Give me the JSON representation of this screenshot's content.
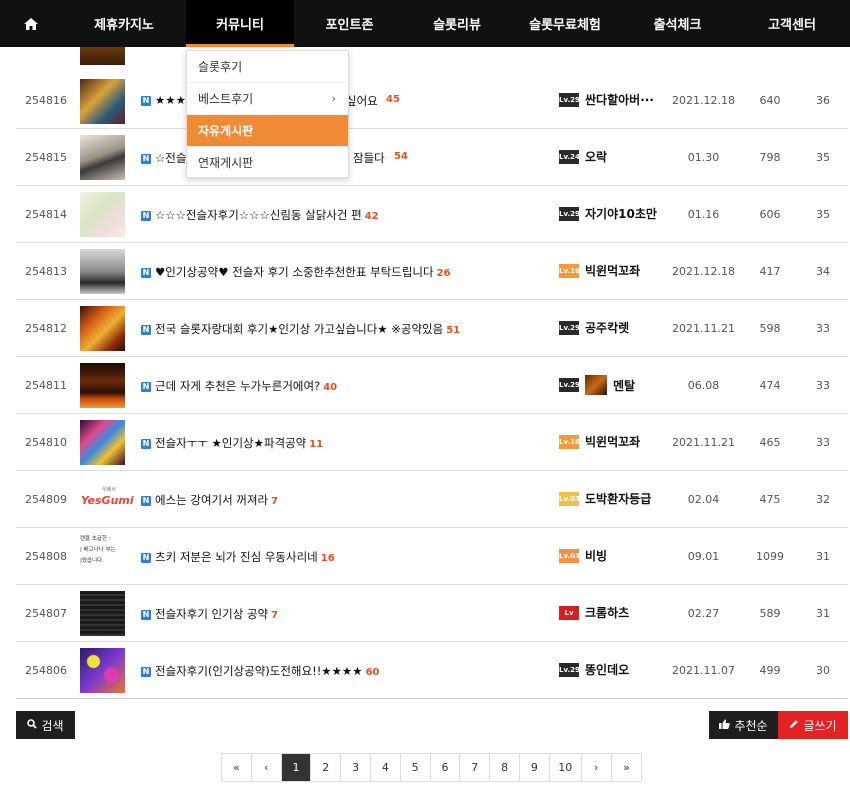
{
  "nav": {
    "items": [
      "제휴카지노",
      "커뮤니티",
      "포인트존",
      "슬롯리뷰",
      "슬롯무료체험",
      "출석체크",
      "고객센터"
    ]
  },
  "dropdown": {
    "items": [
      "슬롯후기",
      "베스트후기",
      "자유게시판",
      "연재게시판"
    ],
    "arrow": "›"
  },
  "rows": [
    {
      "num": "254816",
      "title": "★★★",
      "title_hidden_end": "싶어요",
      "comments": "45",
      "level": "Lv.29",
      "author": "싼다할아버···",
      "date": "2021.12.18",
      "views": "640",
      "rec": "36"
    },
    {
      "num": "254815",
      "title": "☆전슬",
      "title_hidden_end": "잠들다",
      "comments": "54",
      "level": "Lv.24",
      "author": "오락",
      "date": "01.30",
      "views": "798",
      "rec": "35"
    },
    {
      "num": "254814",
      "title": "☆☆☆전슬자후기☆☆☆신림동 살닭사건 편",
      "comments": "42",
      "level": "Lv.29",
      "author": "자기야10초만",
      "date": "01.16",
      "views": "606",
      "rec": "35"
    },
    {
      "num": "254813",
      "title": "♥인기상공약♥ 전슬자 후기 소중한추천한표 부탁드립니다",
      "comments": "26",
      "level": "Lv.16",
      "author": "빅윈먹꼬좌",
      "date": "2021.12.18",
      "views": "417",
      "rec": "34"
    },
    {
      "num": "254812",
      "title": "전국 슬롯자랑대회 후기★인기상 가고싶습니다★ ※공약있음",
      "comments": "51",
      "level": "Lv.29",
      "author": "공주칵렛",
      "date": "2021.11.21",
      "views": "598",
      "rec": "33"
    },
    {
      "num": "254811",
      "title": "근데 자게 추천은 누가누른거에여?",
      "comments": "40",
      "level": "Lv.29",
      "author": "멘탈",
      "date": "06.08",
      "views": "474",
      "rec": "33"
    },
    {
      "num": "254810",
      "title": "전슬자ㅜㅜ ★인기상★파격공약",
      "comments": "11",
      "level": "Lv.16",
      "author": "빅윈먹꼬좌",
      "date": "2021.11.21",
      "views": "465",
      "rec": "33"
    },
    {
      "num": "254809",
      "title": "에스는 강여기서 꺼져라",
      "comments": "7",
      "level": "Lv.03",
      "author": "도박환자등급",
      "date": "02.04",
      "views": "475",
      "rec": "32"
    },
    {
      "num": "254808",
      "title": "츠키 저분은 뇌가 진심 우동사리네",
      "comments": "16",
      "level": "Lv.03",
      "author": "비빙",
      "date": "09.01",
      "views": "1099",
      "rec": "31"
    },
    {
      "num": "254807",
      "title": "전슬자후기 인기상 공약",
      "comments": "7",
      "level": "Lv",
      "author": "크롬하츠",
      "date": "02.27",
      "views": "589",
      "rec": "31"
    },
    {
      "num": "254806",
      "title": "전슬자후기(인기상공약)도전해요!!★★★★",
      "comments": "60",
      "level": "Lv.29",
      "author": "똥인데오",
      "date": "2021.11.07",
      "views": "499",
      "rec": "30"
    }
  ],
  "thumb_text": {
    "yes": "YesGumi",
    "yes_sub": "우메서",
    "note_lines": [
      "렌을 초급한 :",
      "| 배고나나 부는",
      "|렸습니다."
    ]
  },
  "buttons": {
    "search": "검색",
    "sort": "추천순",
    "write": "글쓰기"
  },
  "pagination": [
    "«",
    "‹",
    "1",
    "2",
    "3",
    "4",
    "5",
    "6",
    "7",
    "8",
    "9",
    "10",
    "›",
    "»"
  ],
  "pagination_active": "1",
  "colors": {
    "accent": "#f08a35",
    "write_button": "#e32323",
    "comment_count": "#e8501b",
    "new_badge": "#2d7fd8"
  }
}
